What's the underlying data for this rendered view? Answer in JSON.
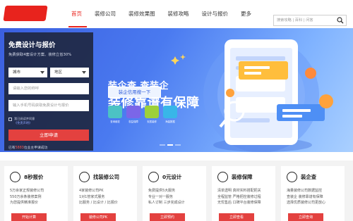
{
  "header": {
    "nav": [
      "首页",
      "装修公司",
      "装修效果图",
      "装修攻略",
      "设计与报价",
      "更多"
    ],
    "search_placeholder": "搜索攻略 | 百科 | 问答"
  },
  "form": {
    "title": "免费设计与报价",
    "subtitle": "免费获取4套设计方案、装修立省30%",
    "city": "城市",
    "district": "地区",
    "name_placeholder": "请输入您的称呼",
    "phone_placeholder": "输入手机号码获取免费设计与报价",
    "agree_text": "我已阅读并同意",
    "agree_link": "《免责声明》",
    "apply_label": "立即申请",
    "footer_prefix": "已有",
    "footer_count": "5883",
    "footer_suffix": "位业主申请成功"
  },
  "banner": {
    "line1": "装企查 查装企",
    "line2": "装修靠谱有保障",
    "button": "装企信用搜一下",
    "tiles": [
      {
        "label": "查询维权",
        "color": "#4cc2c4"
      },
      {
        "label": "权益保障",
        "color": "#7b66e8"
      },
      {
        "label": "安居装修",
        "color": "#9dd03a"
      },
      {
        "label": "海量数据",
        "color": "#38b6e8"
      }
    ]
  },
  "features": [
    {
      "title": "8秒报价",
      "icon": "calculator-icon",
      "desc": [
        "5万余家正规装修公司",
        "550万余条装修案例",
        "为您提供精准报价"
      ],
      "button": "开始计算"
    },
    {
      "title": "找装修公司",
      "icon": "magnifier-icon",
      "desc": [
        "4家装修公司PK",
        "1对1管家式服务",
        "比服务 / 比设计 / 比报价"
      ],
      "button": "装修公司PK"
    },
    {
      "title": "0元设计",
      "icon": "pencil-icon",
      "desc": [
        "免费提供5大服务",
        "专业一对一服务",
        "私人订制 三步完成设计"
      ],
      "button": "立即预约"
    },
    {
      "title": "装修保障",
      "icon": "shield-icon",
      "desc": [
        "清单透明 真材实料搭配把关",
        "全程监管 严格把控装修过程",
        "无忧售后 口碑平台装修保障"
      ],
      "button": "立即查看"
    },
    {
      "title": "装企查",
      "icon": "file-icon",
      "desc": [
        "海量装修公司数据监控",
        "查装企 装修靠谱有保障",
        "选择优质装修公司更放心"
      ],
      "button": "立即查询"
    }
  ]
}
